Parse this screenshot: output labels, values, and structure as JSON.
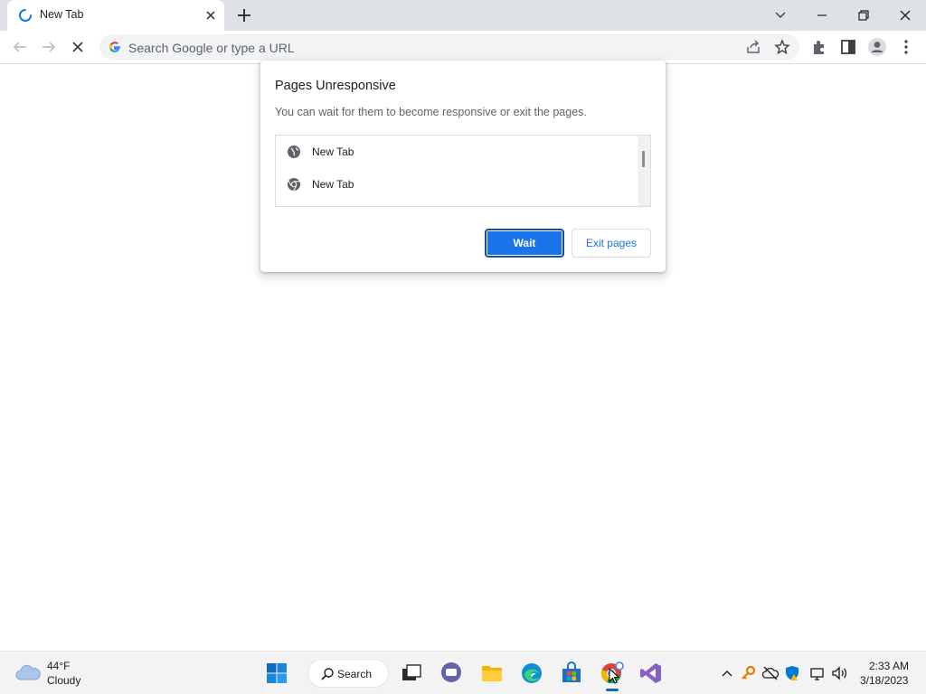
{
  "browser": {
    "tab": {
      "title": "New Tab"
    },
    "omnibox": {
      "placeholder": "Search Google or type a URL"
    }
  },
  "dialog": {
    "title": "Pages Unresponsive",
    "message": "You can wait for them to become responsive or exit the pages.",
    "pages": [
      {
        "label": "New Tab",
        "icon": "globe-icon"
      },
      {
        "label": "New Tab",
        "icon": "chrome-icon"
      }
    ],
    "wait_label": "Wait",
    "exit_label": "Exit pages"
  },
  "taskbar": {
    "weather": {
      "temp": "44°F",
      "condition": "Cloudy"
    },
    "search_label": "Search",
    "clock": {
      "time": "2:33 AM",
      "date": "3/18/2023"
    }
  },
  "colors": {
    "accent": "#1a73e8",
    "tabstrip": "#dee1e6",
    "taskbar": "#f3f3f3"
  }
}
